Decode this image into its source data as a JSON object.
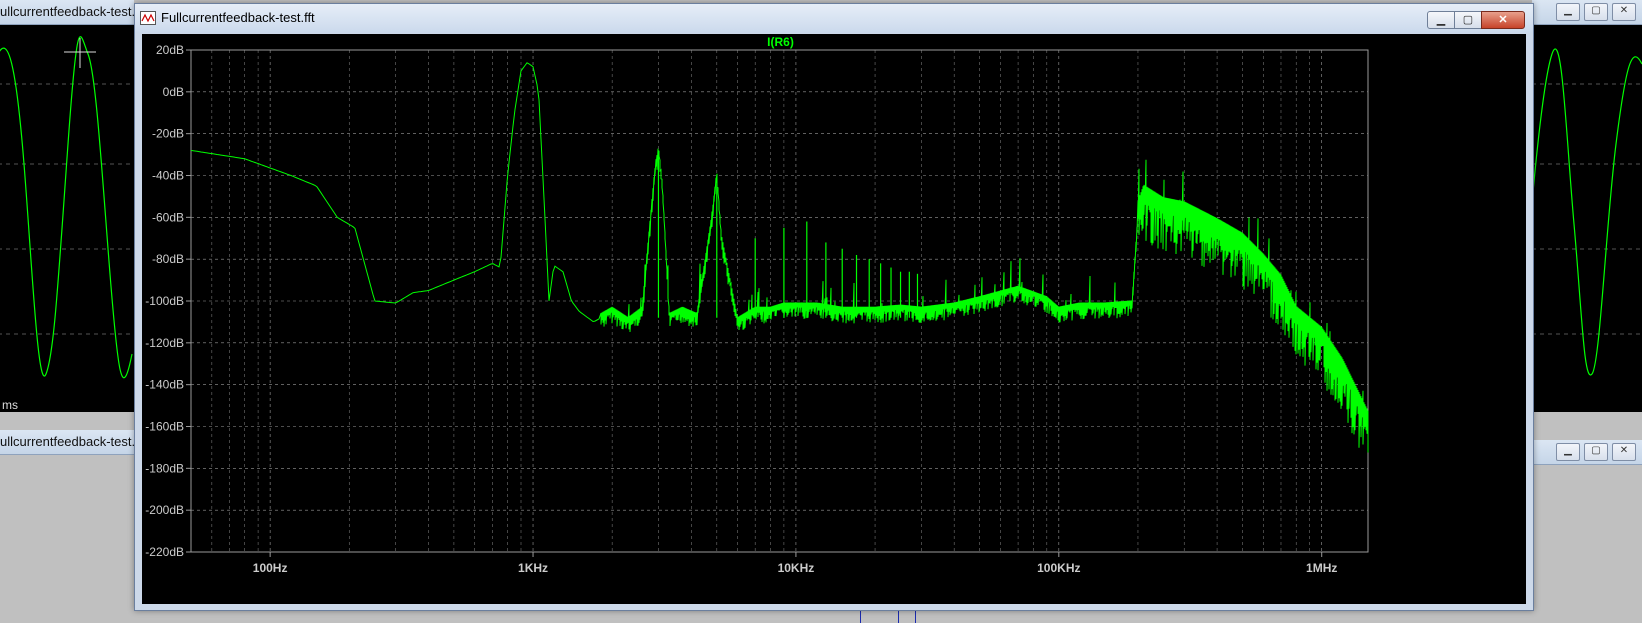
{
  "background_windows": {
    "left_top_title": "ullcurrentfeedback-test.r",
    "left_bottom_title": "ullcurrentfeedback-test.a",
    "left_axis_label": "ms"
  },
  "window": {
    "title": "Fullcurrentfeedback-test.fft",
    "minimize_label": "▁",
    "maximize_label": "▢",
    "close_label": "✕"
  },
  "colors": {
    "trace": "#00ff00",
    "grid": "#9a9a9a",
    "label": "#cccccc",
    "background": "#000000"
  },
  "chart_data": {
    "type": "line",
    "title": "I(R6)",
    "xscale": "log",
    "xlim": [
      50,
      1500000
    ],
    "ylim": [
      -220,
      20
    ],
    "x_ticks": [
      {
        "value": 100,
        "label": "100Hz"
      },
      {
        "value": 1000,
        "label": "1KHz"
      },
      {
        "value": 10000,
        "label": "10KHz"
      },
      {
        "value": 100000,
        "label": "100KHz"
      },
      {
        "value": 1000000,
        "label": "1MHz"
      }
    ],
    "y_ticks": [
      {
        "value": 20,
        "label": "20dB"
      },
      {
        "value": 0,
        "label": "0dB"
      },
      {
        "value": -20,
        "label": "-20dB"
      },
      {
        "value": -40,
        "label": "-40dB"
      },
      {
        "value": -60,
        "label": "-60dB"
      },
      {
        "value": -80,
        "label": "-80dB"
      },
      {
        "value": -100,
        "label": "-100dB"
      },
      {
        "value": -120,
        "label": "-120dB"
      },
      {
        "value": -140,
        "label": "-140dB"
      },
      {
        "value": -160,
        "label": "-160dB"
      },
      {
        "value": -180,
        "label": "-180dB"
      },
      {
        "value": -200,
        "label": "-200dB"
      },
      {
        "value": -220,
        "label": "-220dB"
      }
    ],
    "grid": true,
    "series": [
      {
        "name": "I(R6)",
        "x": [
          50,
          80,
          120,
          150,
          180,
          210,
          250,
          300,
          350,
          400,
          500,
          600,
          700,
          750,
          800,
          850,
          900,
          950,
          1000,
          1050,
          1100,
          1150,
          1200,
          1300,
          1400,
          1500,
          1700,
          2000,
          2300,
          2600,
          2900,
          3000,
          3100,
          3300,
          3700,
          4200,
          4800,
          5000,
          5200,
          6000,
          7000,
          8000,
          9000,
          10000,
          12000,
          15000,
          20000,
          25000,
          30000,
          40000,
          50000,
          70000,
          90000,
          100000,
          120000,
          150000,
          190000,
          200000,
          210000,
          250000,
          300000,
          400000,
          500000,
          600000,
          700000,
          800000,
          1000000,
          1200000,
          1500000
        ],
        "y": [
          -28,
          -32,
          -40,
          -45,
          -60,
          -65,
          -100,
          -101,
          -96,
          -95,
          -90,
          -86,
          -82,
          -84,
          -40,
          -10,
          10,
          14,
          12,
          0,
          -50,
          -100,
          -83,
          -86,
          -100,
          -105,
          -110,
          -105,
          -110,
          -105,
          -40,
          -28,
          -45,
          -108,
          -105,
          -108,
          -60,
          -40,
          -70,
          -110,
          -105,
          -105,
          -103,
          -103,
          -103,
          -105,
          -105,
          -104,
          -105,
          -103,
          -100,
          -95,
          -100,
          -105,
          -103,
          -103,
          -102,
          -60,
          -52,
          -58,
          -60,
          -68,
          -75,
          -85,
          -95,
          -110,
          -120,
          -135,
          -160
        ]
      }
    ]
  }
}
